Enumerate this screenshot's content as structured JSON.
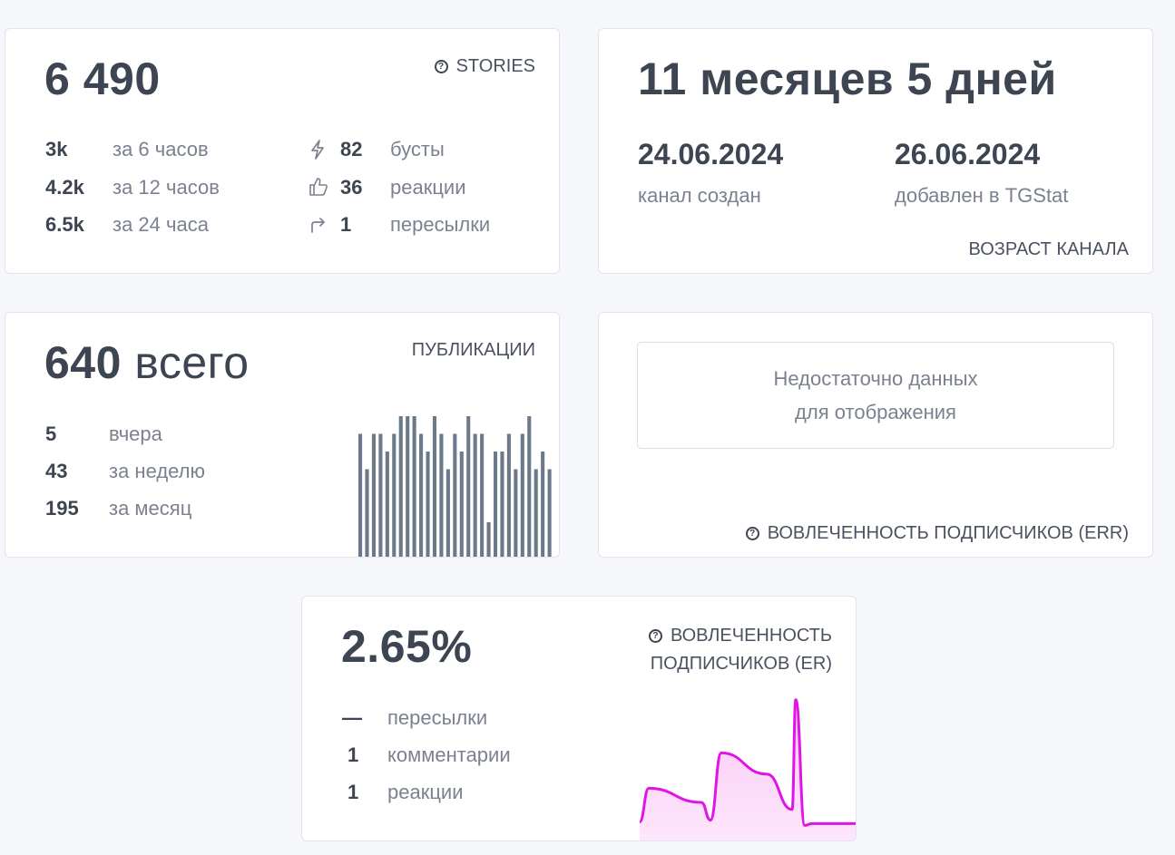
{
  "stories_card": {
    "value": "6 490",
    "label": "STORIES",
    "stats": [
      {
        "num": "3k",
        "text": "за 6 часов"
      },
      {
        "num": "4.2k",
        "text": "за 12 часов"
      },
      {
        "num": "6.5k",
        "text": "за 24 часа"
      }
    ],
    "activity": [
      {
        "icon": "lightning-icon",
        "num": "82",
        "text": "бусты"
      },
      {
        "icon": "thumbs-up-icon",
        "num": "36",
        "text": "реакции"
      },
      {
        "icon": "share-arrow-icon",
        "num": "1",
        "text": "пересылки"
      }
    ]
  },
  "age_card": {
    "value": "11 месяцев 5 дней",
    "created_date": "24.06.2024",
    "created_label": "канал создан",
    "added_date": "26.06.2024",
    "added_label": "добавлен в TGStat",
    "label": "ВОЗРАСТ КАНАЛА"
  },
  "posts_card": {
    "value_num": "640",
    "value_text": "всего",
    "label": "ПУБЛИКАЦИИ",
    "stats": [
      {
        "num": "5",
        "text": "вчера"
      },
      {
        "num": "43",
        "text": "за неделю"
      },
      {
        "num": "195",
        "text": "за месяц"
      }
    ],
    "bar_color": "#6b7a8a",
    "bars": [
      7,
      5,
      7,
      7,
      6,
      7,
      8,
      8,
      8,
      7,
      6,
      8,
      7,
      5,
      7,
      6,
      8,
      7,
      7,
      2,
      6,
      6,
      7,
      5,
      7,
      8,
      5,
      6,
      5
    ]
  },
  "err_card": {
    "message_line1": "Недостаточно данных",
    "message_line2": "для отображения",
    "label": "ВОВЛЕЧЕННОСТЬ ПОДПИСЧИКОВ (ERR)"
  },
  "er_card": {
    "value": "2.65%",
    "label_line1": "ВОВЛЕЧЕННОСТЬ",
    "label_line2": "ПОДПИСЧИКОВ (ER)",
    "stats": [
      {
        "num": "—",
        "text": "пересылки"
      },
      {
        "num": "1",
        "text": "комментарии"
      },
      {
        "num": "1",
        "text": "реакции"
      }
    ],
    "line_color": "#e014e6",
    "fill_color": "#fbc8f7",
    "series": [
      0.45,
      1.4,
      1.0,
      0.5,
      2.4,
      1.8,
      0.8,
      3.9,
      0.35,
      0.4,
      0.4
    ]
  }
}
